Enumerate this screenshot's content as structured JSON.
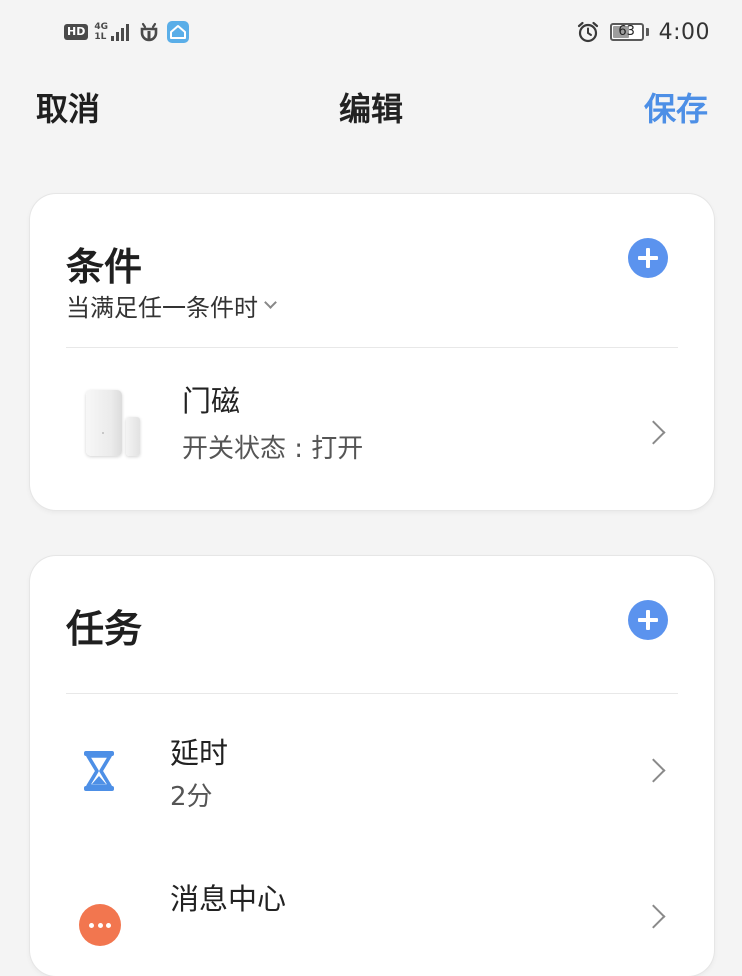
{
  "status_bar": {
    "hd": "HD",
    "network_top": "4G",
    "network_bottom": "1L",
    "battery_level": 63,
    "battery_text": "63",
    "time": "4:00",
    "icons": [
      "signal-icon",
      "bug-icon",
      "smart-home-icon",
      "alarm-icon",
      "battery-icon"
    ]
  },
  "nav": {
    "cancel_label": "取消",
    "title": "编辑",
    "save_label": "保存",
    "save_color": "#4d8fe6"
  },
  "conditions": {
    "title": "条件",
    "add_icon": "plus-circle-icon",
    "match_mode": "当满足任一条件时",
    "items": [
      {
        "icon": "door-sensor-icon",
        "name": "门磁",
        "detail": "开关状态 : 打开"
      }
    ]
  },
  "tasks": {
    "title": "任务",
    "add_icon": "plus-circle-icon",
    "items": [
      {
        "icon": "hourglass-icon",
        "name": "延时",
        "detail": "2分"
      },
      {
        "icon": "message-icon",
        "name": "消息中心",
        "detail": ""
      }
    ]
  },
  "colors": {
    "accent": "#5b93ee",
    "hourglass": "#4d8fe6",
    "message": "#f2764f",
    "background": "#f4f4f4"
  }
}
